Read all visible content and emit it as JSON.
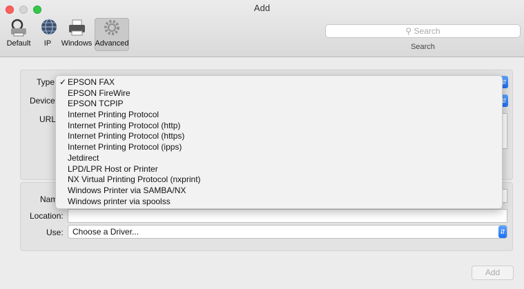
{
  "window": {
    "title": "Add"
  },
  "toolbar": {
    "items": [
      {
        "label": "Default",
        "icon": "default-printer-icon"
      },
      {
        "label": "IP",
        "icon": "globe-icon"
      },
      {
        "label": "Windows",
        "icon": "windows-printer-icon"
      },
      {
        "label": "Advanced",
        "icon": "gear-icon"
      }
    ],
    "search_placeholder": "Search",
    "search_label": "Search"
  },
  "form": {
    "type_label": "Type",
    "device_label": "Device",
    "url_label": "URL",
    "name_label": "Nam",
    "location_label": "Location:",
    "location_value": "",
    "use_label": "Use:",
    "use_value": "Choose a Driver..."
  },
  "type_menu": {
    "checkmark": "✓",
    "selected_index": 0,
    "highlighted_index": 12,
    "items": [
      "EPSON FAX",
      "EPSON FireWire",
      "EPSON TCPIP",
      "Internet Printing Protocol",
      "Internet Printing Protocol (http)",
      "Internet Printing Protocol (https)",
      "Internet Printing Protocol (ipps)",
      "Jetdirect",
      "LPD/LPR Host or Printer",
      "NX Virtual Printing Protocol (nxprint)",
      "Windows Printer via SAMBA/NX",
      "Windows printer via spoolss"
    ]
  },
  "buttons": {
    "add_label": "Add"
  },
  "colors": {
    "accent": "#2e6ee6",
    "close": "#fc605c",
    "maximize": "#34c84a"
  }
}
